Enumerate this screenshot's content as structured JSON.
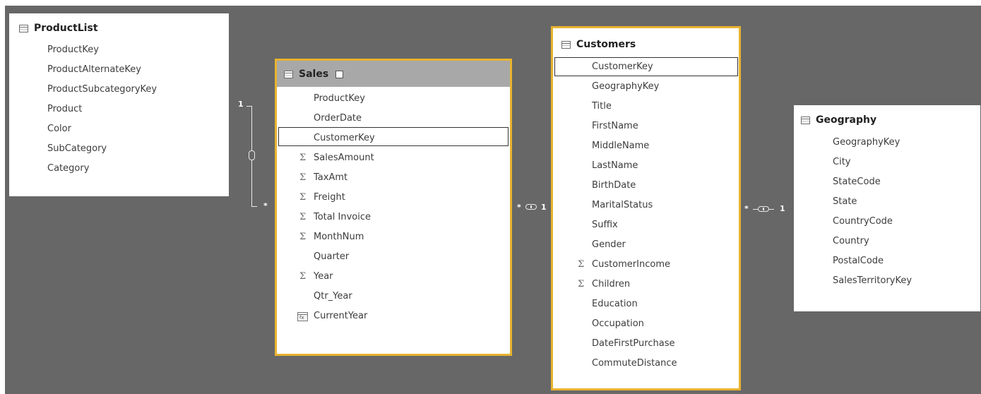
{
  "tables": {
    "productlist": {
      "title": "ProductList",
      "fields": [
        "ProductKey",
        "ProductAlternateKey",
        "ProductSubcategoryKey",
        "Product",
        "Color",
        "SubCategory",
        "Category"
      ]
    },
    "sales": {
      "title": "Sales",
      "fields": [
        {
          "name": "ProductKey",
          "icon": ""
        },
        {
          "name": "OrderDate",
          "icon": ""
        },
        {
          "name": "CustomerKey",
          "icon": ""
        },
        {
          "name": "SalesAmount",
          "icon": "sigma"
        },
        {
          "name": "TaxAmt",
          "icon": "sigma"
        },
        {
          "name": "Freight",
          "icon": "sigma"
        },
        {
          "name": "Total Invoice",
          "icon": "sigma"
        },
        {
          "name": "MonthNum",
          "icon": "sigma"
        },
        {
          "name": "Quarter",
          "icon": ""
        },
        {
          "name": "Year",
          "icon": "sigma"
        },
        {
          "name": "Qtr_Year",
          "icon": ""
        },
        {
          "name": "CurrentYear",
          "icon": "calculated-column"
        }
      ]
    },
    "customers": {
      "title": "Customers",
      "fields": [
        {
          "name": "CustomerKey",
          "icon": ""
        },
        {
          "name": "GeographyKey",
          "icon": ""
        },
        {
          "name": "Title",
          "icon": ""
        },
        {
          "name": "FirstName",
          "icon": ""
        },
        {
          "name": "MiddleName",
          "icon": ""
        },
        {
          "name": "LastName",
          "icon": ""
        },
        {
          "name": "BirthDate",
          "icon": ""
        },
        {
          "name": "MaritalStatus",
          "icon": ""
        },
        {
          "name": "Suffix",
          "icon": ""
        },
        {
          "name": "Gender",
          "icon": ""
        },
        {
          "name": "CustomerIncome",
          "icon": "sigma"
        },
        {
          "name": "Children",
          "icon": "sigma"
        },
        {
          "name": "Education",
          "icon": ""
        },
        {
          "name": "Occupation",
          "icon": ""
        },
        {
          "name": "DateFirstPurchase",
          "icon": ""
        },
        {
          "name": "CommuteDistance",
          "icon": ""
        }
      ]
    },
    "geography": {
      "title": "Geography",
      "fields": [
        "GeographyKey",
        "City",
        "StateCode",
        "State",
        "CountryCode",
        "Country",
        "PostalCode",
        "SalesTerritoryKey"
      ]
    }
  },
  "relationships": {
    "productlist_sales": {
      "one": "1",
      "many": "*"
    },
    "sales_customers": {
      "many": "*",
      "one": "1"
    },
    "customers_geography": {
      "many": "*",
      "one": "1"
    }
  },
  "icons": {
    "sigma_glyph": "Σ",
    "calc_glyph": "fx"
  },
  "colors": {
    "canvas": "#676767",
    "selected_border": "#e8b32f",
    "sales_header": "#a8a8a8"
  }
}
